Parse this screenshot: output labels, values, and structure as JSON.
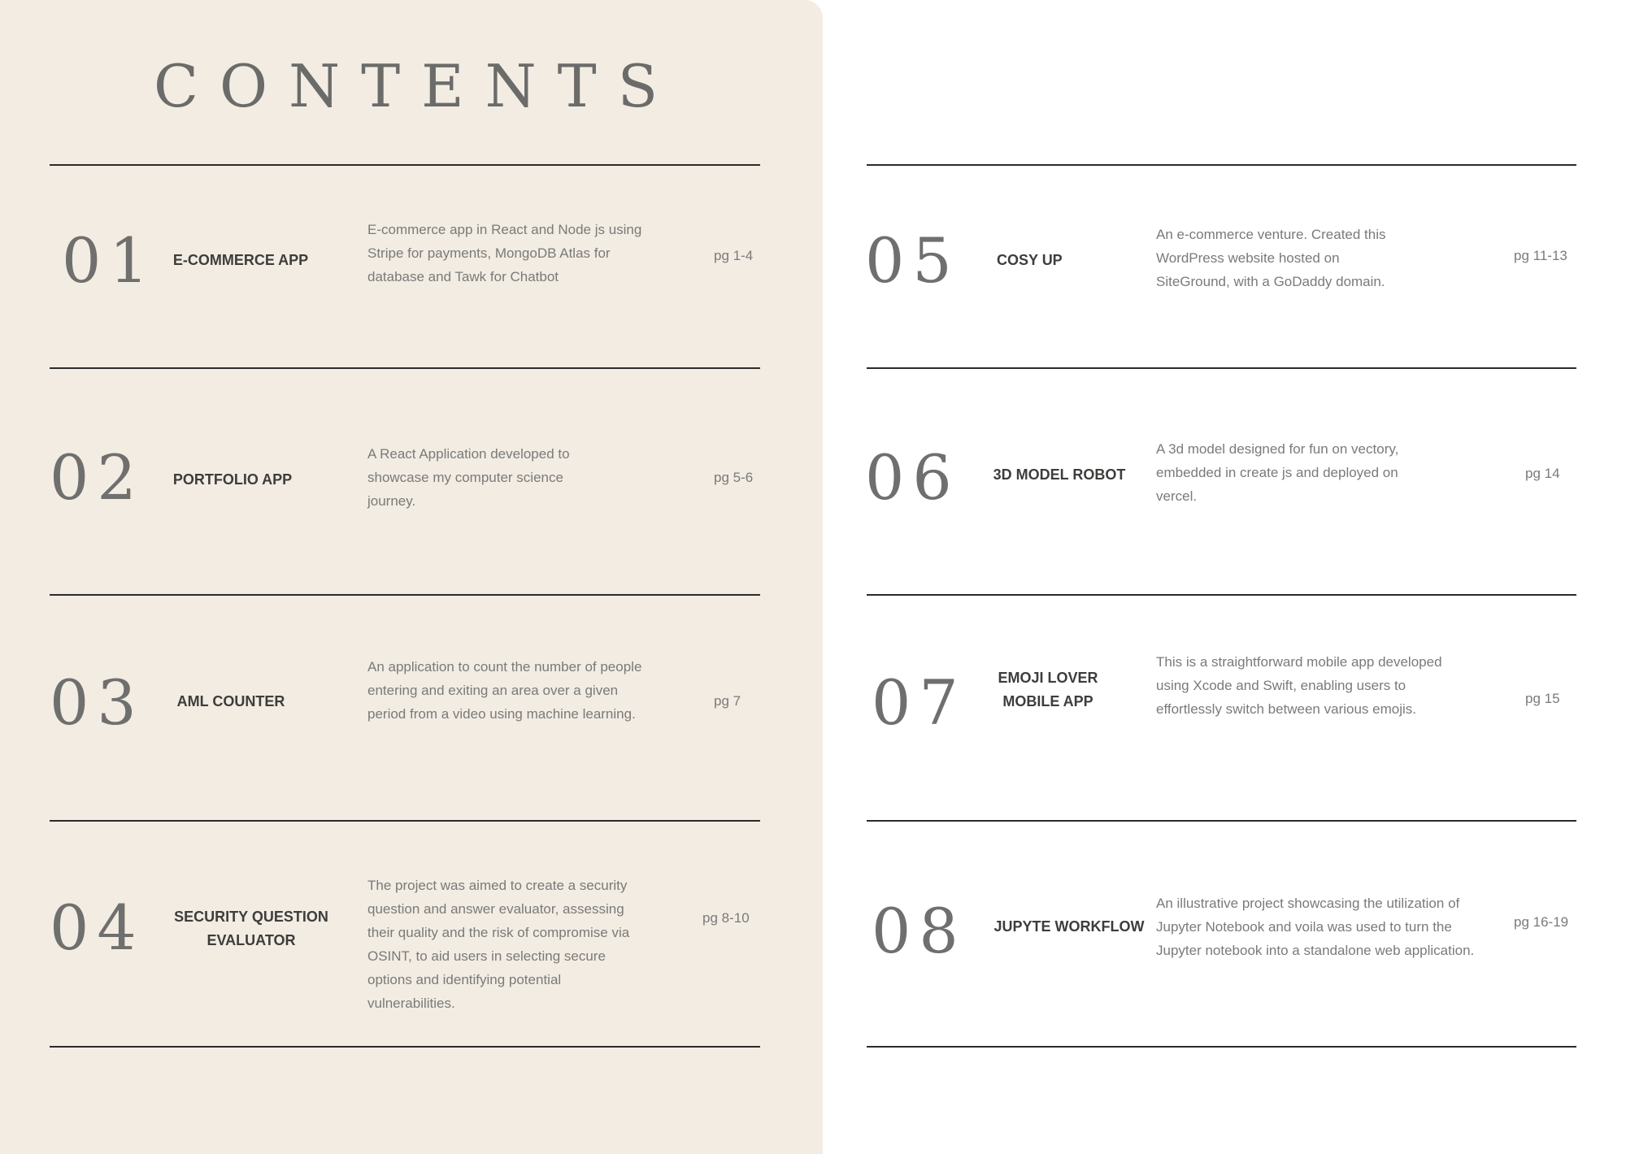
{
  "title": "CONTENTS",
  "entries": [
    {
      "num": "01",
      "name": "E-COMMERCE APP",
      "desc": "E-commerce app in React and Node js using Stripe for payments, MongoDB Atlas for database and Tawk for Chatbot",
      "page": "pg 1-4"
    },
    {
      "num": "02",
      "name": "PORTFOLIO APP",
      "desc": "A React Application developed to showcase my computer science journey.",
      "page": "pg 5-6"
    },
    {
      "num": "03",
      "name": "AML COUNTER",
      "desc": "An application to count the number of people entering and exiting an area over a given period from a video using machine learning.",
      "page": "pg 7"
    },
    {
      "num": "04",
      "name": "SECURITY QUESTION EVALUATOR",
      "desc": "The project was aimed to create a security question and answer evaluator, assessing their quality and the risk of compromise via OSINT, to aid users in selecting secure options and identifying potential vulnerabilities.",
      "page": "pg 8-10"
    },
    {
      "num": "05",
      "name": "COSY UP",
      "desc": "An e-commerce venture. Created this WordPress website hosted on SiteGround, with a GoDaddy domain.",
      "page": "pg 11-13"
    },
    {
      "num": "06",
      "name": "3D MODEL ROBOT",
      "desc": "A 3d model designed for fun on vectory, embedded in create js and deployed on vercel.",
      "page": "pg 14"
    },
    {
      "num": "07",
      "name": "EMOJI LOVER MOBILE APP",
      "desc": "This is a straightforward mobile app developed using Xcode and Swift, enabling users to effortlessly switch between various emojis.",
      "page": "pg 15"
    },
    {
      "num": "08",
      "name": "JUPYTE WORKFLOW",
      "desc": "An illustrative project showcasing the utilization of Jupyter Notebook and voila was used to turn the Jupyter notebook into a standalone web application.",
      "page": "pg 16-19"
    }
  ]
}
